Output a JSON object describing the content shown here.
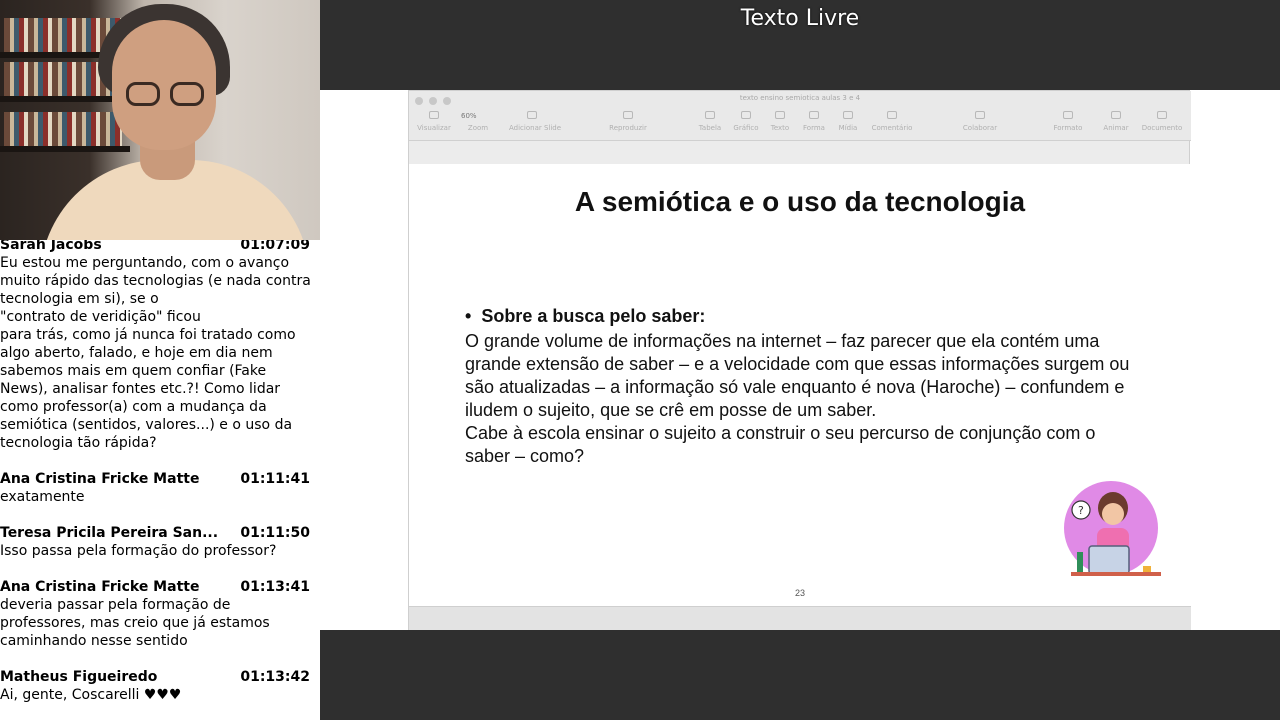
{
  "room": {
    "title": "Texto Livre"
  },
  "chat": {
    "messages": [
      {
        "author": "Sarah Jacobs",
        "time": "01:07:09",
        "text": "Eu estou me perguntando, com o avanço muito rápido das tecnologias (e nada contra tecnologia em si), se o\n\"contrato de veridição\" ficou\npara trás, como já nunca foi tratado como algo aberto, falado, e hoje em dia nem sabemos mais em quem confiar (Fake News), analisar fontes etc.?! Como lidar como professor(a) com a mudança da semiótica (sentidos, valores...) e o uso da tecnologia tão rápida?"
      },
      {
        "author": "Ana Cristina Fricke Matte",
        "time": "01:11:41",
        "text": "exatamente"
      },
      {
        "author": "Teresa Pricila Pereira San...",
        "time": "01:11:50",
        "text": "Isso passa pela formação do professor?"
      },
      {
        "author": "Ana Cristina Fricke Matte",
        "time": "01:13:41",
        "text": "deveria passar pela formação de professores, mas creio que já estamos caminhando nesse sentido"
      },
      {
        "author": "Matheus Figueiredo",
        "time": "01:13:42",
        "text": "Ai, gente, Coscarelli ♥♥♥"
      }
    ]
  },
  "keynote": {
    "doc_title": "texto ensino semiotica aulas 3 e 4",
    "zoom": "60%",
    "toolbar": [
      {
        "label": "Visualizar",
        "icon": "view-icon"
      },
      {
        "label": "Zoom",
        "icon": "zoom-icon"
      },
      {
        "label": "Adicionar Slide",
        "icon": "add-slide-icon"
      },
      {
        "label": "Reproduzir",
        "icon": "play-icon"
      },
      {
        "label": "Tabela",
        "icon": "table-icon"
      },
      {
        "label": "Gráfico",
        "icon": "chart-icon"
      },
      {
        "label": "Texto",
        "icon": "text-icon"
      },
      {
        "label": "Forma",
        "icon": "shape-icon"
      },
      {
        "label": "Mídia",
        "icon": "media-icon"
      },
      {
        "label": "Comentário",
        "icon": "comment-icon"
      },
      {
        "label": "Colaborar",
        "icon": "collaborate-icon"
      },
      {
        "label": "Formato",
        "icon": "format-icon"
      },
      {
        "label": "Animar",
        "icon": "animate-icon"
      },
      {
        "label": "Documento",
        "icon": "document-icon"
      }
    ]
  },
  "slide": {
    "title": "A semiótica e o uso da tecnologia",
    "bullet_heading": "Sobre a busca pelo saber:",
    "body": "O grande volume de informações na internet – faz parecer que ela contém uma grande extensão de saber –  e a velocidade com que essas informações surgem ou são atualizadas – a informação só vale enquanto é nova (Haroche) – confundem e iludem o sujeito, que se crê em posse de um saber.\nCabe à escola ensinar o sujeito a construir o seu percurso de conjunção com o saber – como?",
    "page_number": "23"
  }
}
